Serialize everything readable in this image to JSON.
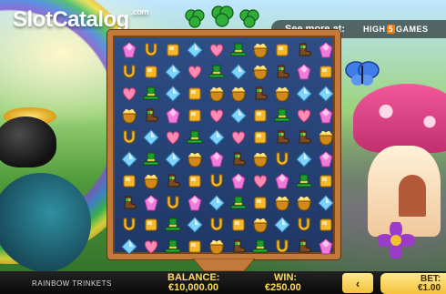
{
  "watermark": {
    "text": "SlotCatalog",
    "suffix": ".com"
  },
  "promo": {
    "text": "See more at:",
    "brand_prefix": "HIGH",
    "brand_five": "5",
    "brand_suffix": "GAMES"
  },
  "board": {
    "rows": [
      [
        "gem-pink",
        "horseshoe",
        "gold-square",
        "gem-blue",
        "heart",
        "hat",
        "pot",
        "gold-square",
        "boot",
        "gem-pink"
      ],
      [
        "horseshoe",
        "gold-square",
        "gem-blue",
        "heart",
        "hat",
        "gem-blue",
        "pot",
        "boot",
        "gem-pink",
        "gold-square"
      ],
      [
        "heart",
        "hat",
        "gem-blue",
        "gold-square",
        "pot",
        "pot",
        "boot",
        "pot",
        "gem-blue",
        "gem-blue"
      ],
      [
        "pot",
        "boot",
        "gem-pink",
        "gold-square",
        "heart",
        "gem-blue",
        "gold-square",
        "hat",
        "heart",
        "gem-pink"
      ],
      [
        "horseshoe",
        "gem-blue",
        "heart",
        "hat",
        "gem-blue",
        "heart",
        "gold-square",
        "boot",
        "boot",
        "pot"
      ],
      [
        "gem-blue",
        "hat",
        "gem-blue",
        "pot",
        "gem-pink",
        "boot",
        "pot",
        "horseshoe",
        "gem-blue",
        "gem-pink"
      ],
      [
        "gold-square",
        "pot",
        "boot",
        "gold-square",
        "horseshoe",
        "gem-pink",
        "heart",
        "gem-pink",
        "hat",
        "gold-square"
      ],
      [
        "boot",
        "gem-pink",
        "horseshoe",
        "gem-pink",
        "gem-blue",
        "hat",
        "gold-square",
        "pot",
        "pot",
        "gem-blue"
      ],
      [
        "horseshoe",
        "gold-square",
        "hat",
        "gem-blue",
        "horseshoe",
        "gold-square",
        "pot",
        "gem-blue",
        "horseshoe",
        "gold-square"
      ],
      [
        "gem-blue",
        "heart",
        "hat",
        "gold-square",
        "pot",
        "boot",
        "hat",
        "horseshoe",
        "boot",
        "gem-pink"
      ]
    ]
  },
  "footer": {
    "game_name": "RAINBOW TRINKETS",
    "balance_label": "BALANCE:",
    "balance_value": "€10,000.00",
    "win_label": "WIN:",
    "win_value": "€250.00",
    "prev_label": "‹",
    "bet_label": "BET:",
    "bet_value": "€1.00"
  },
  "colors": {
    "accent": "#f3c23c",
    "frame": "#c27a3b",
    "board_bg": "#2f4e86",
    "footer_text": "#ffdc5a"
  }
}
